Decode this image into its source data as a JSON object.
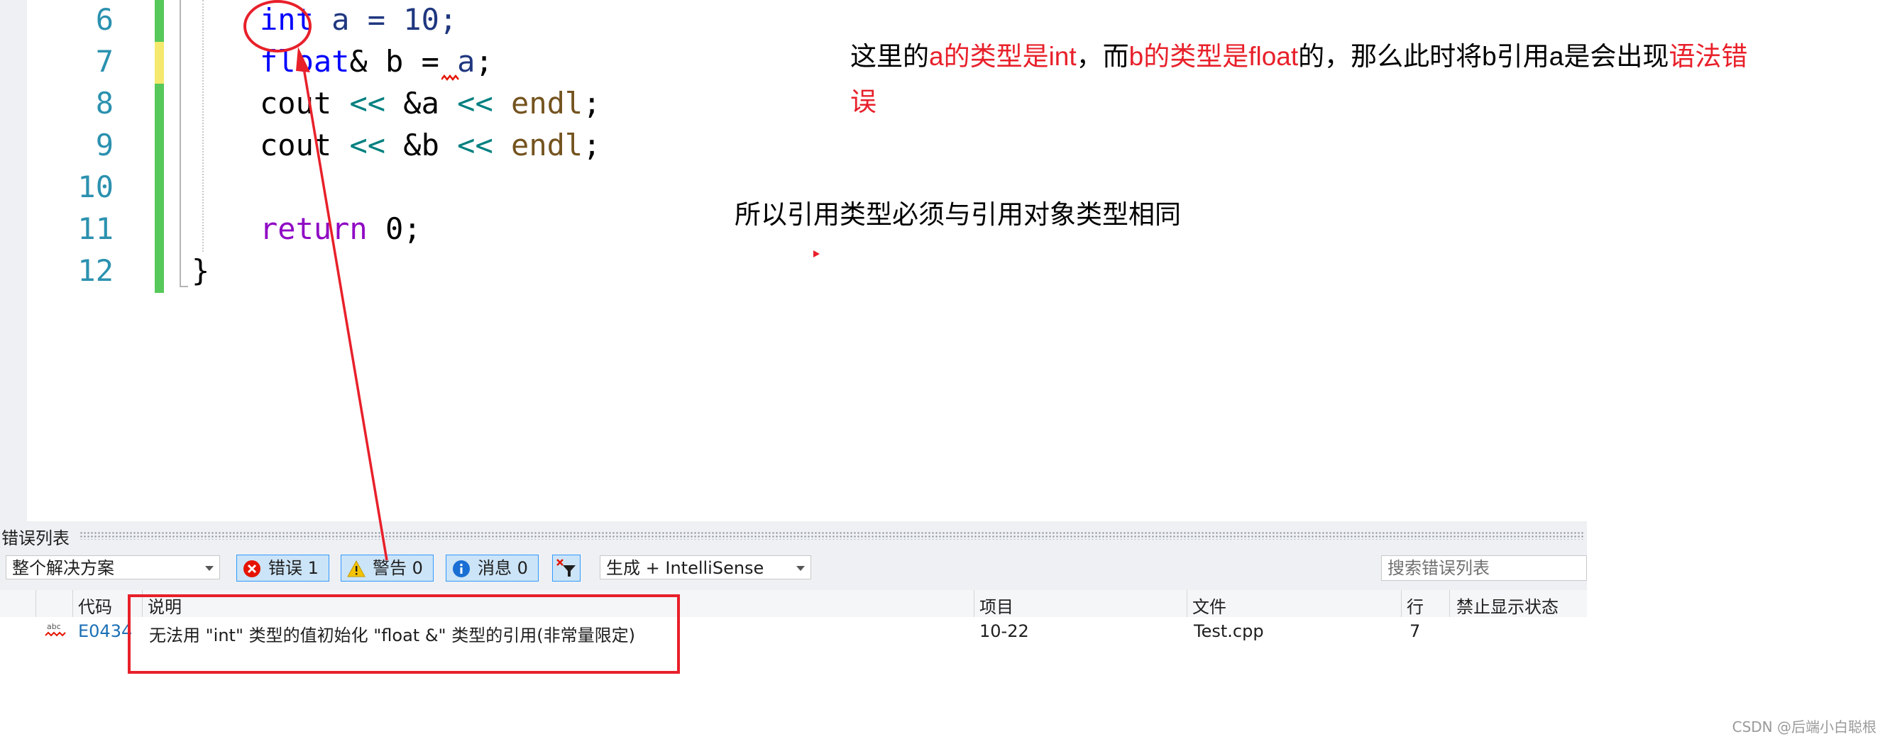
{
  "editor": {
    "lines": [
      {
        "num": "6",
        "change": "green"
      },
      {
        "num": "7",
        "change": "yellow"
      },
      {
        "num": "8",
        "change": "green"
      },
      {
        "num": "9",
        "change": "green"
      },
      {
        "num": "10",
        "change": "green"
      },
      {
        "num": "11",
        "change": "green"
      },
      {
        "num": "12",
        "change": "green"
      }
    ],
    "code": {
      "l6": {
        "kw": "int",
        "rest": " a = 10;"
      },
      "l7": {
        "kw": "float",
        "amp": "& b = ",
        "var": "a",
        "semi": ";"
      },
      "l8": {
        "a": "cout ",
        "op": "<<",
        "b": " &a ",
        "op2": "<<",
        "fn": " endl",
        "semi": ";"
      },
      "l9": {
        "a": "cout ",
        "op": "<<",
        "b": " &b ",
        "op2": "<<",
        "fn": " endl",
        "semi": ";"
      },
      "l11": {
        "kw": "return",
        "rest": " 0;"
      },
      "l12": {
        "brace": "}"
      }
    }
  },
  "annotations": {
    "note1": {
      "p1": "这里的",
      "p2": "a的类型是int",
      "p3": "，而",
      "p4": "b的类型是float",
      "p5": "的，那么此时将b引用a是会出现",
      "p6": "语法错",
      "p7": "误"
    },
    "note2": "所以引用类型必须与引用对象类型相同"
  },
  "error_list": {
    "title": "错误列表",
    "scope": "整个解决方案",
    "errors_btn": "错误 1",
    "warnings_btn": "警告 0",
    "messages_btn": "消息 0",
    "build_filter": "生成 + IntelliSense",
    "search_placeholder": "搜索错误列表",
    "columns": [
      "代码",
      "说明",
      "项目",
      "文件",
      "行",
      "禁止显示状态"
    ],
    "rows": [
      {
        "code": "E0434",
        "description": "无法用 \"int\" 类型的值初始化 \"float &\" 类型的引用(非常量限定)",
        "project": "10-22",
        "file": "Test.cpp",
        "line": "7",
        "suppression": ""
      }
    ]
  },
  "watermark": "CSDN @后端小白聪根",
  "colors": {
    "accent_red": "#e8202a",
    "keyword": "#0000ff",
    "line_number": "#2b91af"
  }
}
